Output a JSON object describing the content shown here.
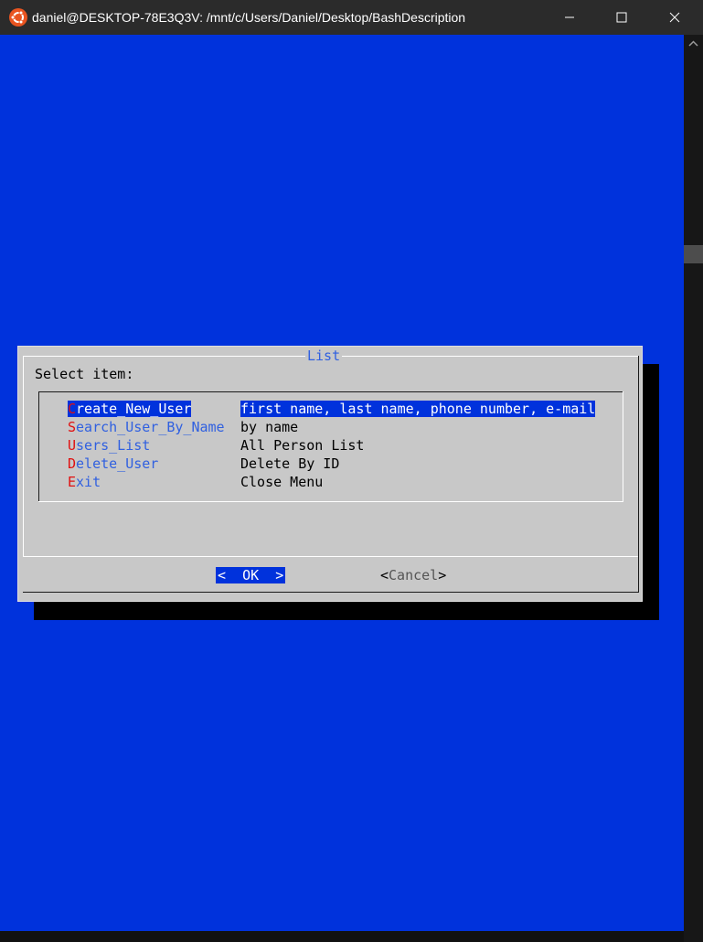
{
  "window": {
    "title": "daniel@DESKTOP-78E3Q3V: /mnt/c/Users/Daniel/Desktop/BashDescription",
    "icon": "ubuntu-icon",
    "controls": [
      "minimize-icon",
      "maximize-icon",
      "close-icon"
    ]
  },
  "dialog": {
    "title": "List",
    "prompt": "Select item:",
    "items": [
      {
        "hotkey": "C",
        "rest": "reate_New_User",
        "description": "first name, last name, phone number, e-mail",
        "selected": true
      },
      {
        "hotkey": "S",
        "rest": "earch_User_By_Name",
        "description": "by name",
        "selected": false
      },
      {
        "hotkey": "U",
        "rest": "sers_List",
        "description": "All Person List",
        "selected": false
      },
      {
        "hotkey": "D",
        "rest": "elete_User",
        "description": "Delete By ID",
        "selected": false
      },
      {
        "hotkey": "E",
        "rest": "xit",
        "description": "Close Menu",
        "selected": false
      }
    ],
    "ok_label": "<  OK  >",
    "cancel_open": "<",
    "cancel_label": "Cancel",
    "cancel_close": ">"
  },
  "colors": {
    "background": "#0032dc",
    "dialog": "#c8c8c8",
    "accent_text": "#3060e0",
    "hotkey": "#e01010"
  }
}
